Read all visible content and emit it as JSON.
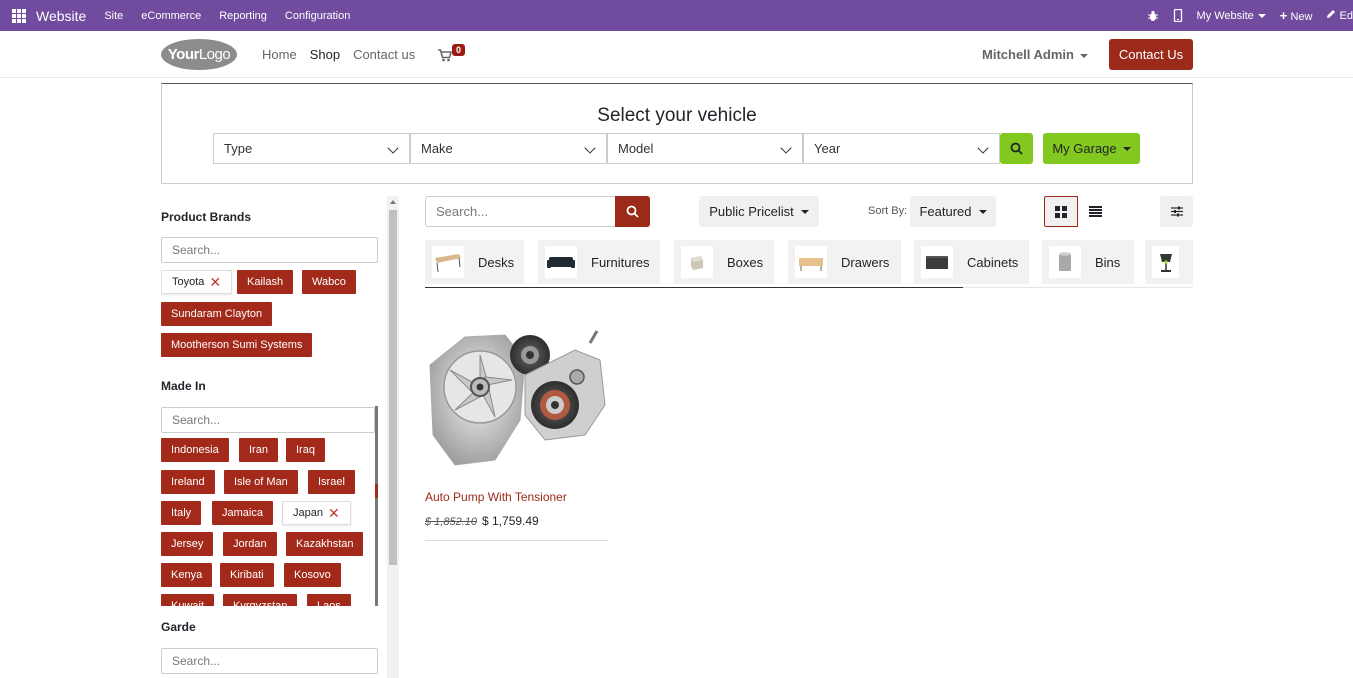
{
  "admin_bar": {
    "brand": "Website",
    "menu": [
      "Site",
      "eCommerce",
      "Reporting",
      "Configuration"
    ],
    "website_label": "My Website",
    "new_label": "New",
    "edit_label": "Ed"
  },
  "header": {
    "logo_bold": "Your",
    "logo_light": "Logo",
    "nav": [
      "Home",
      "Shop",
      "Contact us"
    ],
    "cart_count": "0",
    "user": "Mitchell Admin",
    "contact_button": "Contact Us"
  },
  "vehicle": {
    "title": "Select your vehicle",
    "selects": [
      "Type",
      "Make",
      "Model",
      "Year"
    ],
    "garage_label": "My Garage"
  },
  "sidebar": {
    "brands_title": "Product Brands",
    "brands_search": "Search...",
    "brands": [
      {
        "label": "Toyota",
        "selected": true
      },
      {
        "label": "Kailash",
        "selected": false
      },
      {
        "label": "Wabco",
        "selected": false
      },
      {
        "label": "Sundaram Clayton",
        "selected": false
      },
      {
        "label": "Mootherson Sumi Systems",
        "selected": false
      }
    ],
    "madein_title": "Made In",
    "madein_search": "Search...",
    "countries": [
      {
        "label": "Indonesia",
        "selected": false
      },
      {
        "label": "Iran",
        "selected": false
      },
      {
        "label": "Iraq",
        "selected": false
      },
      {
        "label": "Ireland",
        "selected": false
      },
      {
        "label": "Isle of Man",
        "selected": false
      },
      {
        "label": "Israel",
        "selected": false
      },
      {
        "label": "Italy",
        "selected": false
      },
      {
        "label": "Jamaica",
        "selected": false
      },
      {
        "label": "Japan",
        "selected": true
      },
      {
        "label": "Jersey",
        "selected": false
      },
      {
        "label": "Jordan",
        "selected": false
      },
      {
        "label": "Kazakhstan",
        "selected": false
      },
      {
        "label": "Kenya",
        "selected": false
      },
      {
        "label": "Kiribati",
        "selected": false
      },
      {
        "label": "Kosovo",
        "selected": false
      },
      {
        "label": "Kuwait",
        "selected": false
      },
      {
        "label": "Kyrgyzstan",
        "selected": false
      },
      {
        "label": "Laos",
        "selected": false
      }
    ],
    "garde_title": "Garde",
    "garde_search": "Search..."
  },
  "toolbar": {
    "search_placeholder": "Search...",
    "pricelist": "Public Pricelist",
    "sort_label": "Sort By:",
    "sort_value": "Featured"
  },
  "categories": [
    "Desks",
    "Furnitures",
    "Boxes",
    "Drawers",
    "Cabinets",
    "Bins",
    ""
  ],
  "product": {
    "name": "Auto Pump With Tensioner",
    "old_price": "$ 1,852.10",
    "price": "$ 1,759.49"
  },
  "colors": {
    "admin_bar": "#714b9e",
    "primary": "#9b2a1a",
    "garage": "#83c81e"
  }
}
